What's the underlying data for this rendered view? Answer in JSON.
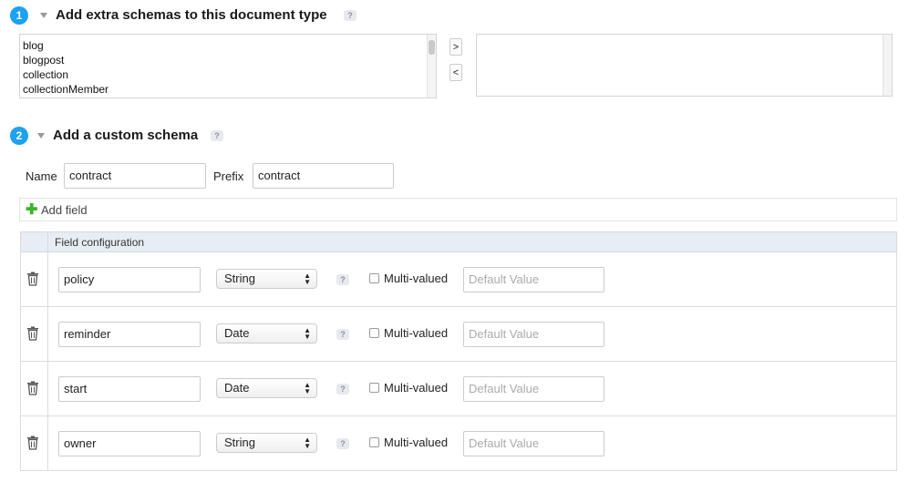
{
  "section1": {
    "number": "1",
    "title": "Add extra schemas to this document type",
    "help": "?",
    "available_schemas": [
      "blog",
      "blogpost",
      "collection",
      "collectionMember"
    ],
    "selected_schemas": [],
    "move_right": ">",
    "move_left": "<"
  },
  "section2": {
    "number": "2",
    "title": "Add a custom schema",
    "help": "?",
    "name_label": "Name",
    "name_value": "contract",
    "prefix_label": "Prefix",
    "prefix_value": "contract",
    "add_field_icon": "plus-icon",
    "add_field_label": "Add field",
    "field_config_header": "Field configuration",
    "fields": [
      {
        "name": "policy",
        "type": "String",
        "help": "?",
        "multi_label": "Multi-valued",
        "multi_checked": false,
        "default_placeholder": "Default Value"
      },
      {
        "name": "reminder",
        "type": "Date",
        "help": "?",
        "multi_label": "Multi-valued",
        "multi_checked": false,
        "default_placeholder": "Default Value"
      },
      {
        "name": "start",
        "type": "Date",
        "help": "?",
        "multi_label": "Multi-valued",
        "multi_checked": false,
        "default_placeholder": "Default Value"
      },
      {
        "name": "owner",
        "type": "String",
        "help": "?",
        "multi_label": "Multi-valued",
        "multi_checked": false,
        "default_placeholder": "Default Value"
      }
    ]
  },
  "colors": {
    "step_badge": "#1da1f2",
    "add_icon": "#3bb22a",
    "header_bg": "#e8edf4"
  }
}
